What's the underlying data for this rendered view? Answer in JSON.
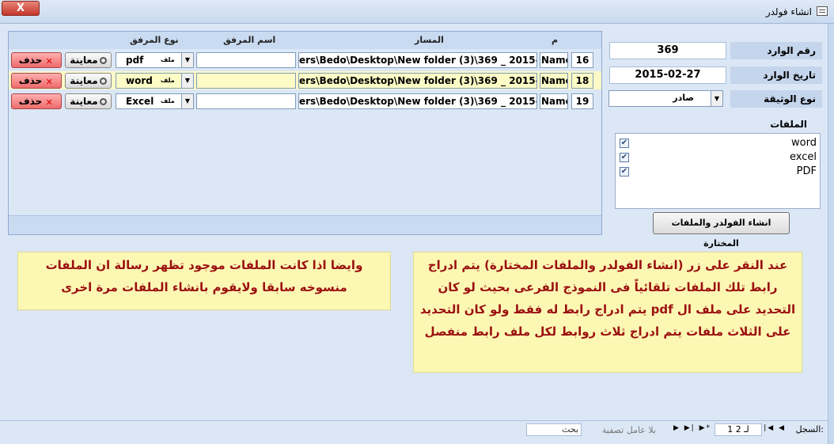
{
  "window": {
    "title": "انشاء فولدر",
    "close_label": "X"
  },
  "subform": {
    "headers": {
      "m": "م",
      "path": "المسار",
      "attachment_name": "اسم المرفق",
      "attachment_type": "نوع المرفق"
    },
    "rows": [
      {
        "num": "16",
        "name": "Name",
        "path": "ers\\Bedo\\Desktop\\New folder (3)\\369 _ 2015-02-27",
        "attachment_name": "",
        "type": "pdf",
        "type_prefix": "ملف",
        "preview": "معاينة",
        "delete": "حذف",
        "selected": false
      },
      {
        "num": "18",
        "name": "Name",
        "path": "ers\\Bedo\\Desktop\\New folder (3)\\369 _ 2015-02-27",
        "attachment_name": "",
        "type": "word",
        "type_prefix": "ملف",
        "preview": "معاينة",
        "delete": "حذف",
        "selected": true
      },
      {
        "num": "19",
        "name": "Name",
        "path": "ers\\Bedo\\Desktop\\New folder (3)\\369 _ 2015-02-27",
        "attachment_name": "",
        "type": "Excel",
        "type_prefix": "ملف",
        "preview": "معاينة",
        "delete": "حذف",
        "selected": false
      }
    ]
  },
  "fields": {
    "incoming_no_label": "رقم الوارد",
    "incoming_no": "369",
    "incoming_date_label": "تاريخ الوارد",
    "incoming_date": "2015-02-27",
    "doc_type_label": "نوع الوثيقة",
    "doc_type": "صادر"
  },
  "files": {
    "label": "الملفات",
    "items": [
      {
        "name": "word",
        "checked": true
      },
      {
        "name": "excel",
        "checked": true
      },
      {
        "name": "PDF",
        "checked": true
      }
    ]
  },
  "create_button": "انشاء الفولدر والملفات المختارة",
  "notes": {
    "right": "عند النقر على زر (انشاء الفولدر والملفات المختارة) يتم ادراج رابط تلك الملفات تلقائياً فى النموذج الفرعى بحيث لو كان التحديد على ملف ال pdf يتم ادراج رابط له فقط ولو كان التحديد على الثلاث ملفات يتم ادراج ثلاث روابط لكل ملف رابط منفصل",
    "left": "وايضا اذا كانت الملفات موجود تظهر رسالة ان الملفات منسوخه سابقا ولايقوم بانشاء الملفات مرة اخرى"
  },
  "navigation": {
    "record_label": "السجل:",
    "position": "1 لـ 2",
    "filter": "بلا عامل تصفية",
    "search": "بحث"
  },
  "colors": {
    "note_bg": "#fcf8b4",
    "note_text": "#9b1010",
    "selected_row": "#fcf9c8",
    "delete_button": "#ee6b6b"
  }
}
